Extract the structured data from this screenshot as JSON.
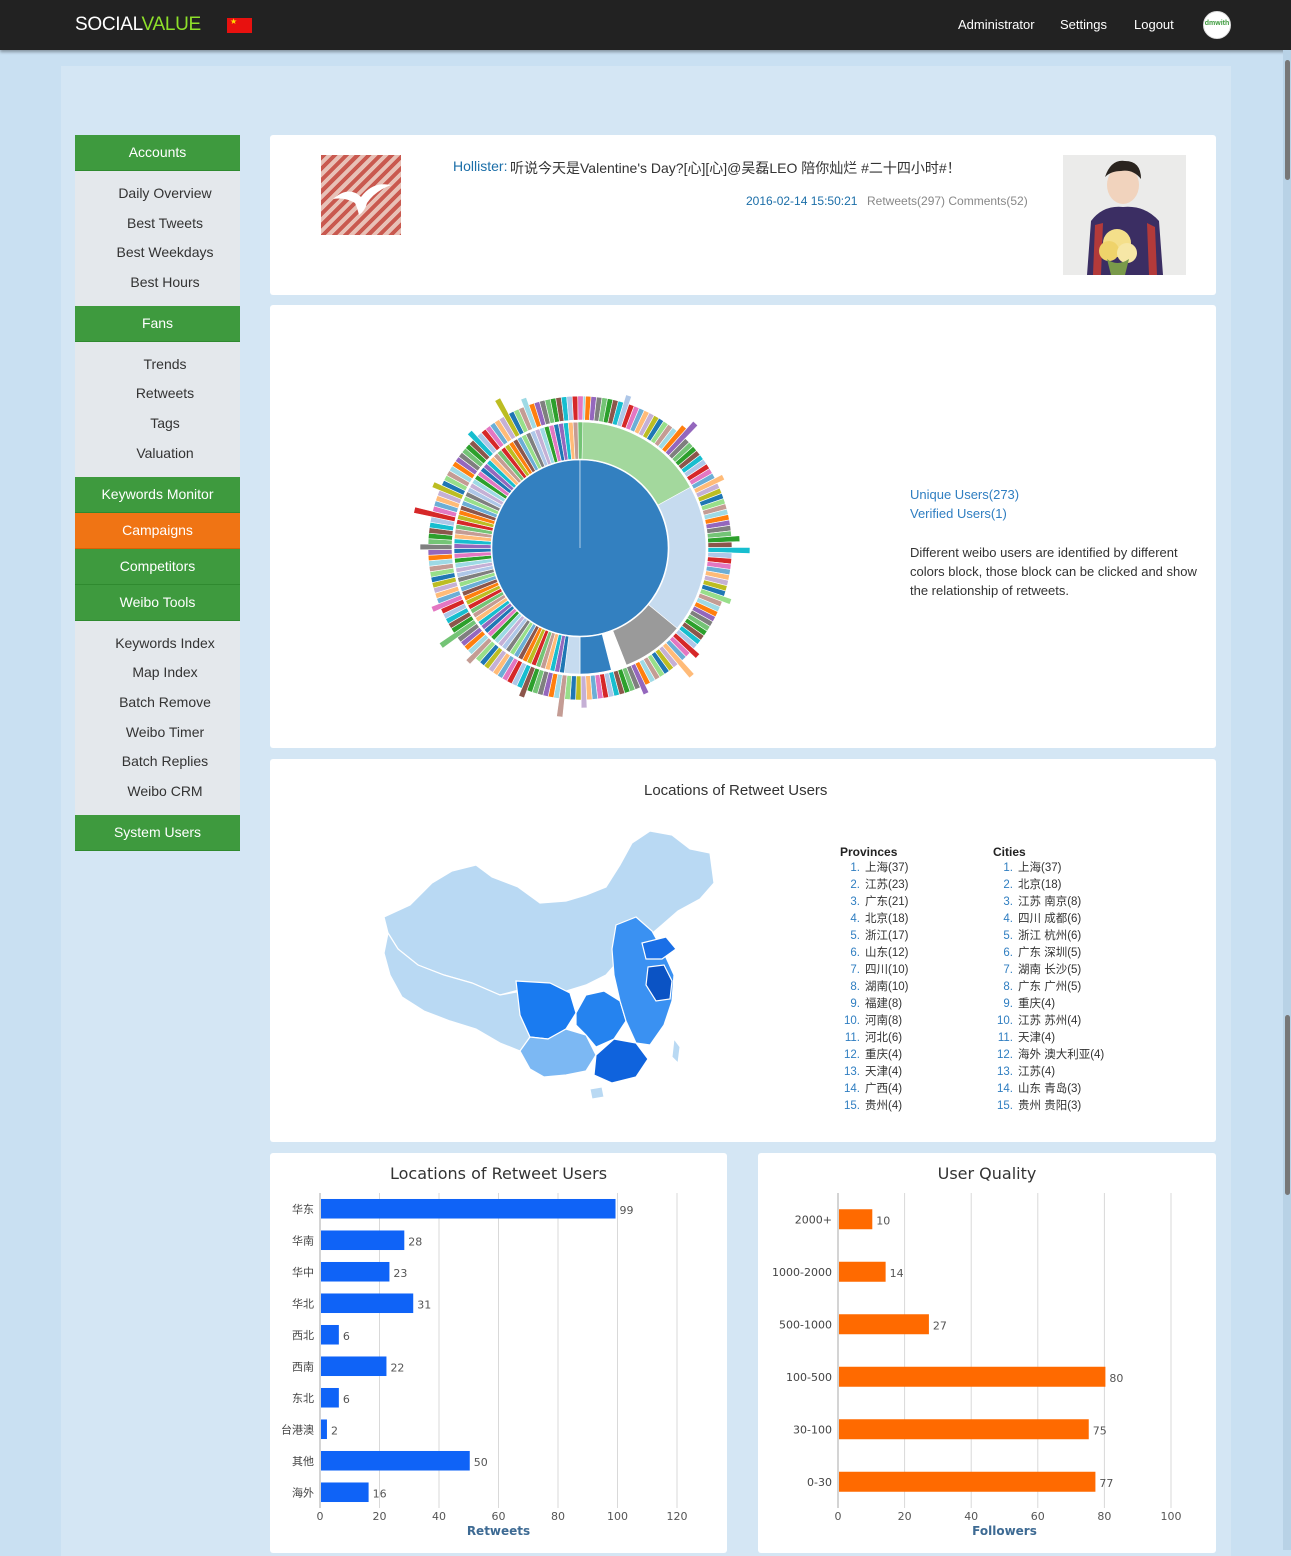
{
  "topbar": {
    "brand_part1": "SOCIAL",
    "brand_part2": "VALUE",
    "links": [
      "Administrator",
      "Settings",
      "Logout"
    ],
    "avatar_text": "dmwith"
  },
  "sidebar": {
    "sections": [
      {
        "label": "Accounts",
        "color": "#3e9a3e",
        "items": [
          "Daily Overview",
          "Best Tweets",
          "Best Weekdays",
          "Best Hours"
        ]
      },
      {
        "label": "Fans",
        "color": "#3e9a3e",
        "items": [
          "Trends",
          "Retweets",
          "Tags",
          "Valuation"
        ]
      },
      {
        "label": "Keywords Monitor",
        "color": "#3e9a3e",
        "items": []
      },
      {
        "label": "Campaigns",
        "color": "#f07414",
        "items": []
      },
      {
        "label": "Competitors",
        "color": "#3e9a3e",
        "items": []
      },
      {
        "label": "Weibo Tools",
        "color": "#3e9a3e",
        "items": [
          "Keywords Index",
          "Map Index",
          "Batch Remove",
          "Weibo Timer",
          "Batch Replies",
          "Weibo CRM"
        ]
      },
      {
        "label": "System Users",
        "color": "#3e9a3e",
        "items": []
      }
    ]
  },
  "tweet": {
    "author": "Hollister:",
    "text": "听说今天是Valentine's Day?[心][心]@吴磊LEO 陪你灿烂 #二十四小时#！",
    "date": "2016-02-14 15:50:21",
    "stats": "Retweets(297) Comments(52)"
  },
  "network": {
    "unique_users": "Unique Users(273)",
    "verified_users": "Verified Users(1)",
    "description": "Different weibo users are identified by different colors block, those block can be clicked and show the relationship of retweets."
  },
  "locations": {
    "title": "Locations of Retweet Users",
    "provinces_title": "Provinces",
    "cities_title": "Cities",
    "provinces": [
      "上海(37)",
      "江苏(23)",
      "广东(21)",
      "北京(18)",
      "浙江(17)",
      "山东(12)",
      "四川(10)",
      "湖南(10)",
      "福建(8)",
      "河南(8)",
      "河北(6)",
      "重庆(4)",
      "天津(4)",
      "广西(4)",
      "贵州(4)"
    ],
    "cities": [
      "上海(37)",
      "北京(18)",
      "江苏 南京(8)",
      "四川 成都(6)",
      "浙江 杭州(6)",
      "广东 深圳(5)",
      "湖南 长沙(5)",
      "广东 广州(5)",
      "重庆(4)",
      "江苏 苏州(4)",
      "天津(4)",
      "海外 澳大利亚(4)",
      "江苏(4)",
      "山东 青岛(3)",
      "贵州 贵阳(3)"
    ]
  },
  "chart_data": [
    {
      "type": "bar",
      "orientation": "horizontal",
      "title": "Locations of Retweet Users",
      "xlabel": "Retweets",
      "ylabel": "",
      "categories": [
        "华东",
        "华南",
        "华中",
        "华北",
        "西北",
        "西南",
        "东北",
        "台港澳",
        "其他",
        "海外"
      ],
      "values": [
        99,
        28,
        23,
        31,
        6,
        22,
        6,
        2,
        50,
        16
      ],
      "xlim": [
        0,
        120
      ],
      "ticks": [
        0,
        20,
        40,
        60,
        80,
        100,
        120
      ],
      "color": "#0f63f7",
      "grid": true
    },
    {
      "type": "bar",
      "orientation": "horizontal",
      "title": "User Quality",
      "xlabel": "Followers",
      "ylabel": "",
      "categories": [
        "2000+",
        "1000-2000",
        "500-1000",
        "100-500",
        "30-100",
        "0-30"
      ],
      "values": [
        10,
        14,
        27,
        80,
        75,
        77
      ],
      "xlim": [
        0,
        100
      ],
      "ticks": [
        0,
        20,
        40,
        60,
        80,
        100
      ],
      "color": "#ff6a00",
      "grid": true
    }
  ]
}
